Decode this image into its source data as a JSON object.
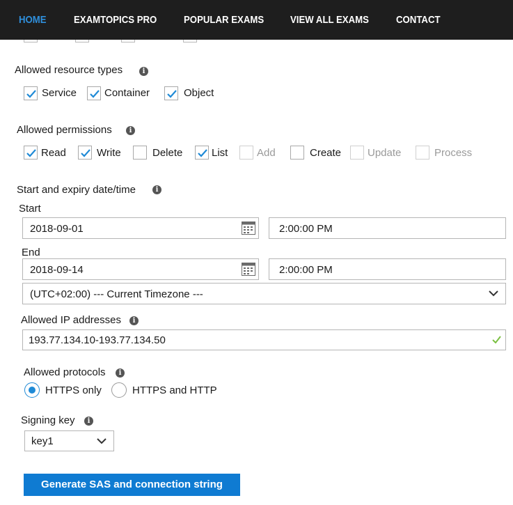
{
  "nav": {
    "items": [
      "HOME",
      "EXAMTOPICS PRO",
      "POPULAR EXAMS",
      "VIEW ALL EXAMS",
      "CONTACT"
    ],
    "active": "HOME"
  },
  "resource_types": {
    "label": "Allowed resource types",
    "options": [
      {
        "label": "Service",
        "checked": true
      },
      {
        "label": "Container",
        "checked": true
      },
      {
        "label": "Object",
        "checked": true
      }
    ]
  },
  "permissions": {
    "label": "Allowed permissions",
    "options": [
      {
        "label": "Read",
        "checked": true,
        "enabled": true
      },
      {
        "label": "Write",
        "checked": true,
        "enabled": true
      },
      {
        "label": "Delete",
        "checked": false,
        "enabled": true
      },
      {
        "label": "List",
        "checked": true,
        "enabled": true
      },
      {
        "label": "Add",
        "checked": false,
        "enabled": false
      },
      {
        "label": "Create",
        "checked": false,
        "enabled": true
      },
      {
        "label": "Update",
        "checked": false,
        "enabled": false
      },
      {
        "label": "Process",
        "checked": false,
        "enabled": false
      }
    ]
  },
  "datetime": {
    "label": "Start and expiry date/time",
    "start_label": "Start",
    "start_date": "2018-09-01",
    "start_time": "2:00:00 PM",
    "end_label": "End",
    "end_date": "2018-09-14",
    "end_time": "2:00:00 PM",
    "timezone": "(UTC+02:00) --- Current Timezone ---"
  },
  "ip": {
    "label": "Allowed IP addresses",
    "value": "193.77.134.10-193.77.134.50"
  },
  "protocols": {
    "label": "Allowed protocols",
    "options": [
      {
        "label": "HTTPS only",
        "selected": true
      },
      {
        "label": "HTTPS and HTTP",
        "selected": false
      }
    ]
  },
  "signing_key": {
    "label": "Signing key",
    "value": "key1"
  },
  "generate_button": "Generate SAS and connection string",
  "colors": {
    "accent": "#1f8ad6",
    "nav_bg": "#1e1e1e",
    "nav_active": "#2f8fdc",
    "button_bg": "#0f7bd2",
    "valid_check": "#7bc043"
  }
}
